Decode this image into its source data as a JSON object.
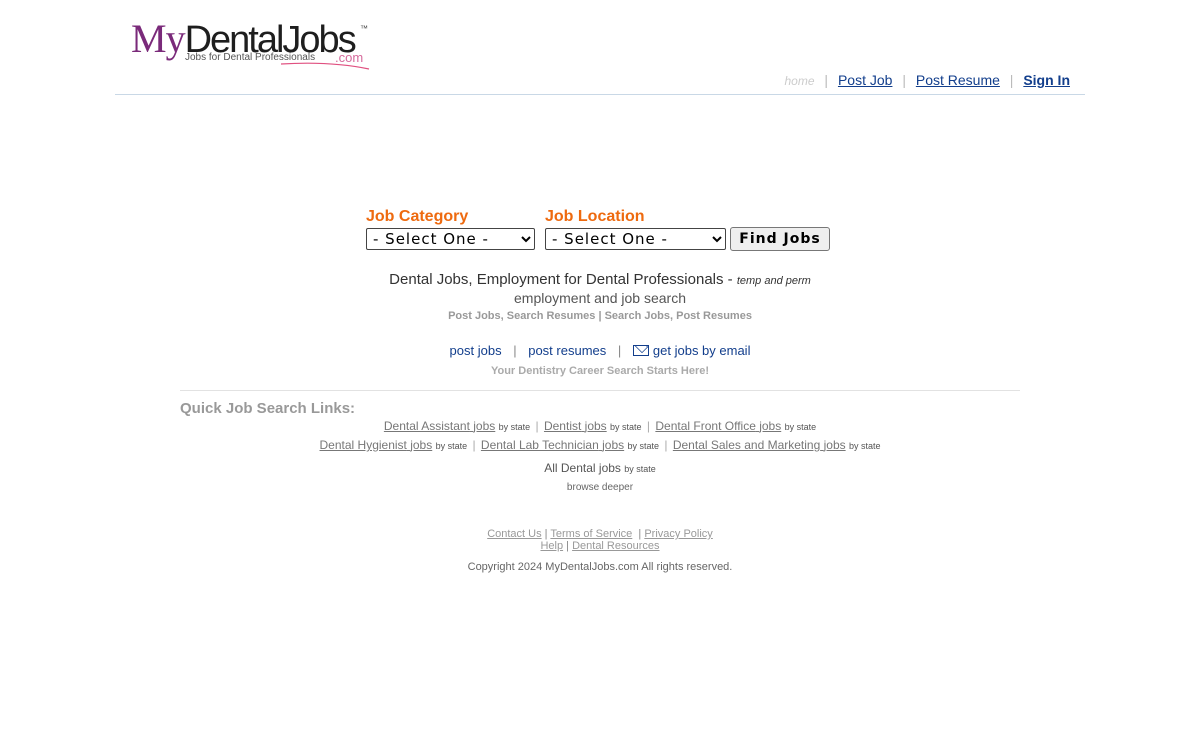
{
  "logo": {
    "my": "My",
    "dental": "DentalJobs",
    "tm": "™",
    "subtitle": "Jobs for Dental Professionals",
    "com": ".com"
  },
  "topnav": {
    "home": "home",
    "post_job": "Post Job",
    "post_resume": "Post Resume",
    "sign_in": "Sign In",
    "sep": "|"
  },
  "search": {
    "category_label": "Job Category",
    "location_label": "Job Location",
    "category_value": "- Select One -",
    "location_value": "- Select One -",
    "find_button": "Find Jobs"
  },
  "intro": {
    "headline": "Dental Jobs, Employment for Dental Professionals -",
    "headline_italic": "temp and perm",
    "line2": "employment and job search",
    "line3": "Post Jobs, Search Resumes | Search Jobs, Post Resumes"
  },
  "quicknav": {
    "post": "post",
    "jobs": "jobs",
    "post_resumes": "post resumes",
    "email_link": "get jobs by email",
    "sep": "|"
  },
  "career_line": "Your Dentistry Career Search Starts Here!",
  "quick_links": {
    "title": "Quick Job Search Links:",
    "by_state": "by state",
    "row1": [
      {
        "name": "Dental Assistant",
        "jobs": "jobs"
      },
      {
        "name": "Dentist",
        "jobs": "jobs"
      },
      {
        "name": "Dental Front Office",
        "jobs": "jobs"
      }
    ],
    "row2": [
      {
        "name": "Dental Hygienist",
        "jobs": "jobs"
      },
      {
        "name": "Dental Lab Technician",
        "jobs": "jobs"
      },
      {
        "name": "Dental Sales and Marketing",
        "jobs": "jobs"
      }
    ],
    "all": "All Dental",
    "all_jobs": "jobs",
    "browse": "browse deeper"
  },
  "footer": {
    "contact": "Contact Us",
    "terms": "Terms of Service",
    "privacy": "Privacy Policy",
    "help": "Help",
    "resources": "Dental Resources",
    "copyright": "Copyright 2024 MyDentalJobs.com All rights reserved."
  },
  "colors": {
    "label_orange": "#ee6a0f",
    "link_blue": "#123e8c",
    "logo_purple": "#7a2a7a"
  }
}
